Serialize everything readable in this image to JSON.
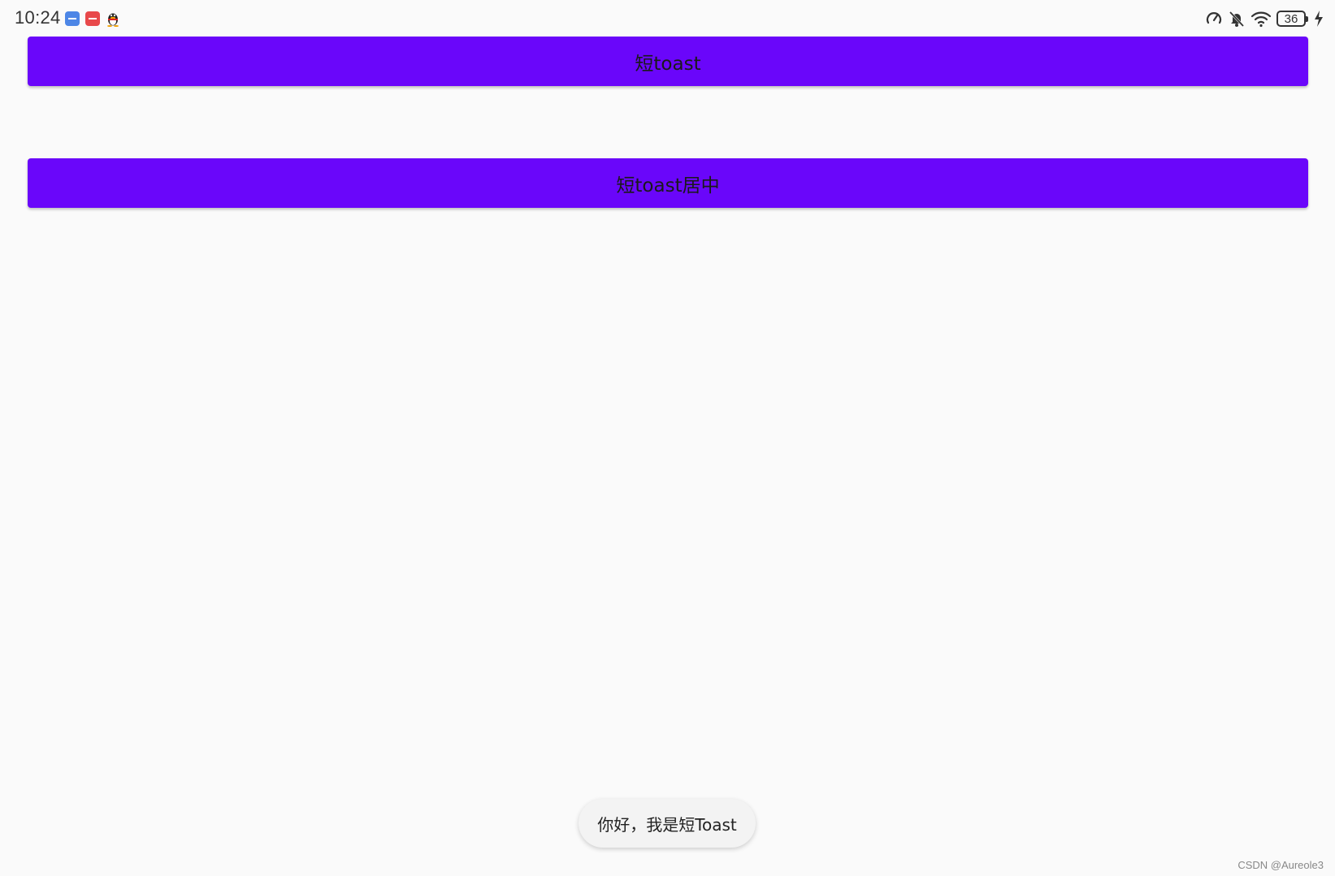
{
  "status_bar": {
    "time": "10:24",
    "battery_level": "36",
    "notification_icons": [
      "blue-app-icon",
      "red-app-icon",
      "qq-penguin-icon"
    ],
    "system_icons": [
      "data-saver-icon",
      "bell-muted-icon",
      "wifi-icon",
      "battery-icon",
      "charging-icon"
    ]
  },
  "buttons": {
    "short_toast_label": "短toast",
    "short_toast_center_label": "短toast居中"
  },
  "toast": {
    "message": "你好，我是短Toast"
  },
  "watermark": {
    "text": "CSDN @Aureole3"
  },
  "colors": {
    "button_background": "#6a06fa",
    "page_background": "#fafafa",
    "toast_background": "#f3f3f3"
  }
}
